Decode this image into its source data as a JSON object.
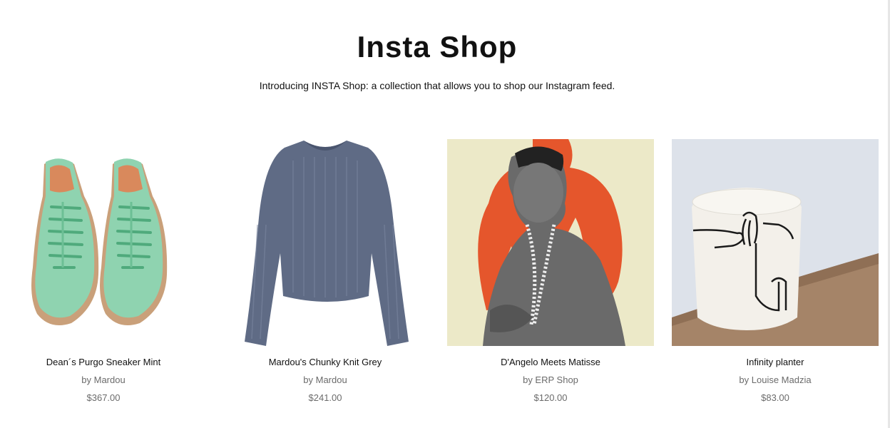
{
  "header": {
    "title": "Insta Shop",
    "intro": "Introducing INSTA Shop: a collection that allows you to shop our Instagram feed."
  },
  "products": [
    {
      "name": "Dean´s Purgo Sneaker Mint",
      "vendor": "by Mardou",
      "price": "$367.00",
      "image_icon": "mint-sneakers-image"
    },
    {
      "name": "Mardou's Chunky Knit Grey",
      "vendor": "by Mardou",
      "price": "$241.00",
      "image_icon": "grey-knit-sweater-image"
    },
    {
      "name": "D'Angelo Meets Matisse",
      "vendor": "by ERP Shop",
      "price": "$120.00",
      "image_icon": "dangelo-matisse-print-image"
    },
    {
      "name": "Infinity planter",
      "vendor": "by Louise Madzia",
      "price": "$83.00",
      "image_icon": "ceramic-planter-image"
    }
  ],
  "colors": {
    "text": "#111111",
    "muted": "#6b6b6b",
    "mint": "#8fd3b0",
    "sweater": "#5f6b85",
    "matisse_orange": "#e5562c",
    "matisse_bg": "#ece9c8"
  }
}
